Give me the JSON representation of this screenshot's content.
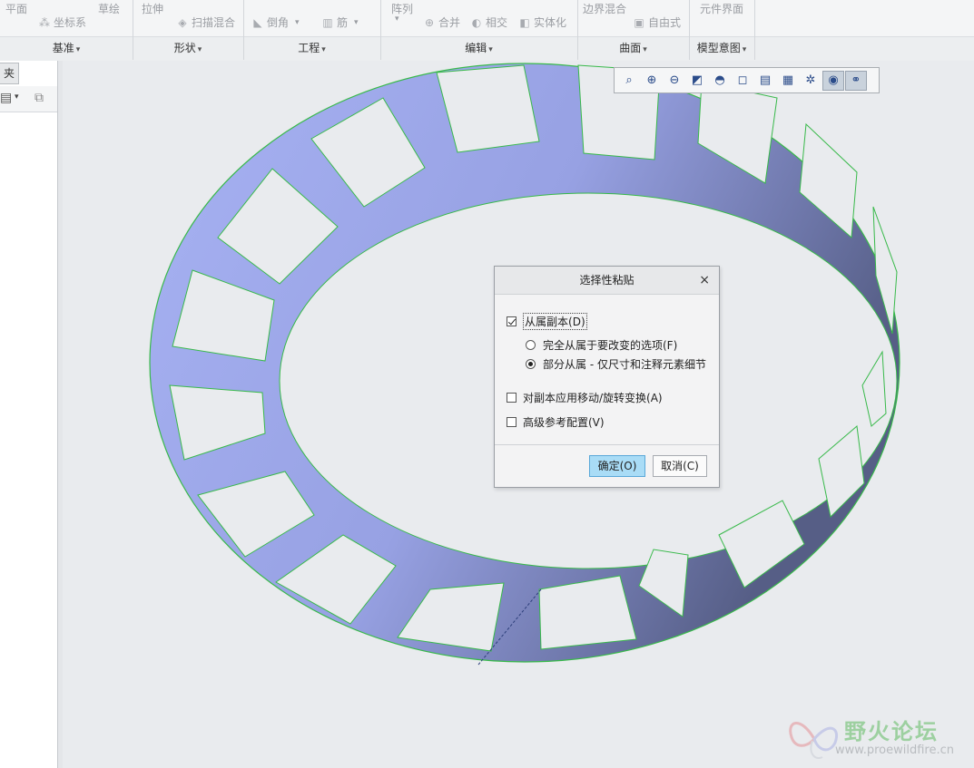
{
  "ribbon": {
    "groups": [
      {
        "label": "基准",
        "items": [
          "平面",
          "草绘",
          "坐标系"
        ]
      },
      {
        "label": "形状",
        "items": [
          "拉伸",
          "扫描混合"
        ]
      },
      {
        "label": "工程",
        "items": [
          "倒角",
          "筋"
        ]
      },
      {
        "label": "编辑",
        "items": [
          "阵列",
          "合并",
          "相交",
          "实体化"
        ]
      },
      {
        "label": "曲面",
        "items": [
          "边界混合",
          "自由式"
        ]
      },
      {
        "label": "模型意图",
        "items": [
          "元件界面"
        ]
      }
    ]
  },
  "left_panel": {
    "tab_label": "夹"
  },
  "dialog": {
    "title": "选择性粘贴",
    "close": "×",
    "dependent_copy": {
      "label": "从属副本",
      "mnemonic": "(D)",
      "checked": true
    },
    "options": [
      {
        "label": "完全从属于要改变的选项(F)",
        "selected": false
      },
      {
        "label": "部分从属 - 仅尺寸和注释元素细节",
        "selected": true
      }
    ],
    "apply_transform": {
      "label": "对副本应用移动/旋转变换(A)",
      "checked": false
    },
    "advanced_ref": {
      "label": "高级参考配置(V)",
      "checked": false
    },
    "ok": "确定(O)",
    "cancel": "取消(C)"
  },
  "watermark": {
    "name": "野火论坛",
    "url": "www.proewildfire.cn"
  },
  "colors": {
    "model_light": "#a7b2f3",
    "model_dark": "#565e86",
    "edge": "#38b94a"
  }
}
